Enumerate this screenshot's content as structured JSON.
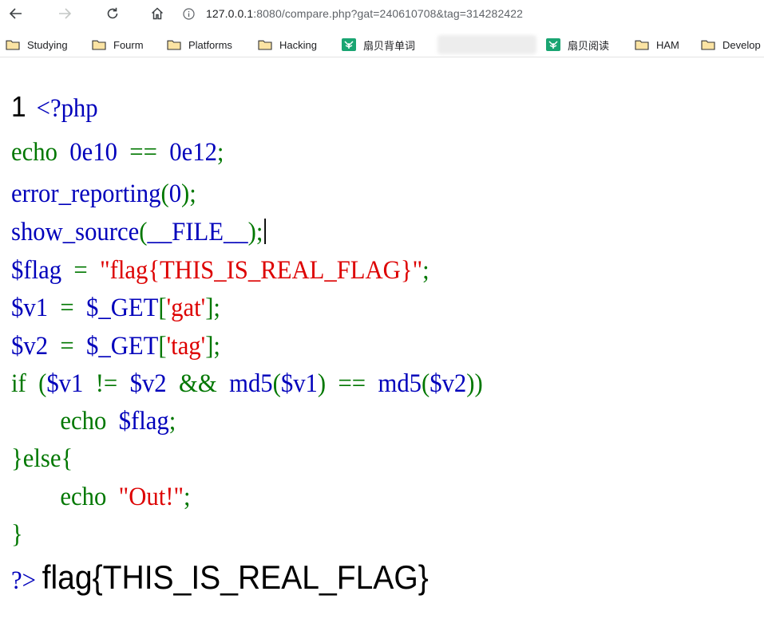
{
  "browser": {
    "url_host": "127.0.0.1",
    "url_rest": ":8080/compare.php?gat=240610708&tag=314282422",
    "icons": {
      "back": "back-arrow-icon",
      "forward": "forward-arrow-icon",
      "reload": "reload-icon",
      "home": "home-icon",
      "info": "info-icon"
    }
  },
  "bookmarks": [
    {
      "label": "Studying",
      "icon": "folder-icon"
    },
    {
      "label": "Fourm",
      "icon": "folder-icon"
    },
    {
      "label": "Platforms",
      "icon": "folder-icon"
    },
    {
      "label": "Hacking",
      "icon": "folder-icon"
    },
    {
      "label": "扇贝背单词",
      "icon": "shanbay-icon"
    },
    {
      "label": "扇贝阅读",
      "icon": "shanbay-icon"
    },
    {
      "label": "HAM",
      "icon": "folder-icon"
    },
    {
      "label": "Develop",
      "icon": "folder-icon"
    }
  ],
  "source": {
    "line_number": "1",
    "lines": [
      [
        {
          "t": "<?php",
          "c": "blue"
        }
      ],
      [
        {
          "t": "echo  ",
          "c": "green"
        },
        {
          "t": "0e10  ",
          "c": "blue"
        },
        {
          "t": "==  ",
          "c": "green"
        },
        {
          "t": "0e12",
          "c": "blue"
        },
        {
          "t": ";",
          "c": "green"
        }
      ],
      [
        {
          "t": "error_reporting",
          "c": "blue"
        },
        {
          "t": "(",
          "c": "green"
        },
        {
          "t": "0",
          "c": "blue"
        },
        {
          "t": ");",
          "c": "green"
        }
      ],
      [
        {
          "t": "show_source",
          "c": "blue"
        },
        {
          "t": "(",
          "c": "green"
        },
        {
          "t": "__FILE__",
          "c": "blue"
        },
        {
          "t": ");",
          "c": "green"
        }
      ],
      [
        {
          "t": "$flag  ",
          "c": "blue"
        },
        {
          "t": "=  ",
          "c": "green"
        },
        {
          "t": "\"flag{THIS_IS_REAL_FLAG}\"",
          "c": "red"
        },
        {
          "t": ";",
          "c": "green"
        }
      ],
      [
        {
          "t": "$v1  ",
          "c": "blue"
        },
        {
          "t": "=  ",
          "c": "green"
        },
        {
          "t": "$_GET",
          "c": "blue"
        },
        {
          "t": "[",
          "c": "green"
        },
        {
          "t": "'gat'",
          "c": "red"
        },
        {
          "t": "];",
          "c": "green"
        }
      ],
      [
        {
          "t": "$v2  ",
          "c": "blue"
        },
        {
          "t": "=  ",
          "c": "green"
        },
        {
          "t": "$_GET",
          "c": "blue"
        },
        {
          "t": "[",
          "c": "green"
        },
        {
          "t": "'tag'",
          "c": "red"
        },
        {
          "t": "];",
          "c": "green"
        }
      ],
      [
        {
          "t": "if  ",
          "c": "green"
        },
        {
          "t": "(",
          "c": "green"
        },
        {
          "t": "$v1  ",
          "c": "blue"
        },
        {
          "t": "!=  ",
          "c": "green"
        },
        {
          "t": "$v2  ",
          "c": "blue"
        },
        {
          "t": "&&  ",
          "c": "green"
        },
        {
          "t": "md5",
          "c": "blue"
        },
        {
          "t": "(",
          "c": "green"
        },
        {
          "t": "$v1",
          "c": "blue"
        },
        {
          "t": ")  ",
          "c": "green"
        },
        {
          "t": "==  ",
          "c": "green"
        },
        {
          "t": "md5",
          "c": "blue"
        },
        {
          "t": "(",
          "c": "green"
        },
        {
          "t": "$v2",
          "c": "blue"
        },
        {
          "t": "))",
          "c": "green"
        }
      ],
      [
        {
          "t": "        echo  ",
          "c": "green"
        },
        {
          "t": "$flag",
          "c": "blue"
        },
        {
          "t": ";",
          "c": "green"
        }
      ],
      [
        {
          "t": "}else{",
          "c": "green"
        }
      ],
      [
        {
          "t": "        echo  ",
          "c": "green"
        },
        {
          "t": "\"Out!\"",
          "c": "red"
        },
        {
          "t": ";",
          "c": "green"
        }
      ],
      [
        {
          "t": "}",
          "c": "green"
        }
      ]
    ],
    "closing_tag": "?>",
    "output": "flag{THIS_IS_REAL_FLAG}"
  },
  "colors": {
    "keyword": "#007700",
    "default": "#0000bb",
    "string": "#dd0000",
    "folder": "#f0b429"
  }
}
